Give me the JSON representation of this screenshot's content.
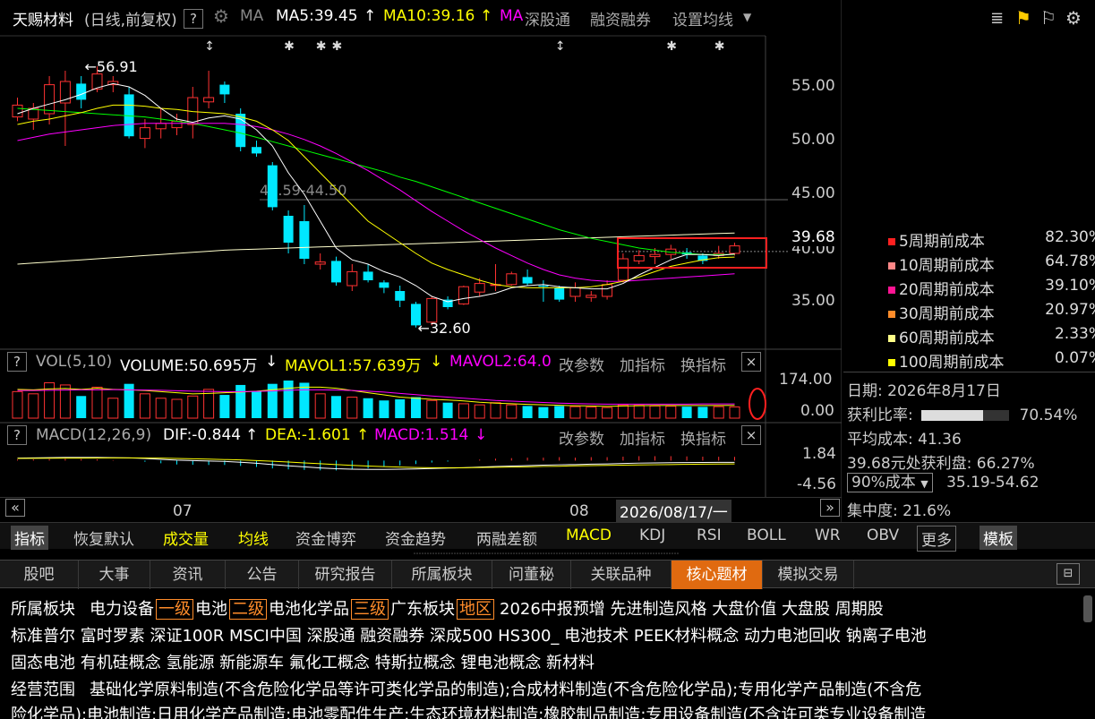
{
  "header": {
    "stock_name": "天赐材料",
    "period_mode": "(日线,前复权)",
    "help": "?",
    "ma_label": "MA",
    "ma5": "MA5:39.45",
    "ma10": "MA10:39.16",
    "ma_more": "MA",
    "shgt": "深股通",
    "rzrq": "融资融券",
    "set_ma": "设置均线",
    "arrow_up": "↑"
  },
  "colors": {
    "up": "#ff3232",
    "down": "#00e8ff",
    "ma5": "#ffffff",
    "ma10": "#ffff00",
    "ma20": "#ff00ff",
    "ma60": "#00ff00",
    "orange": "#ff8c2a",
    "tab_active": "#e06a10"
  },
  "price_axis": {
    "ticks": [
      "55.00",
      "50.00",
      "45.00",
      "40.00",
      "35.00"
    ],
    "current": "39.68",
    "high_label": "56.91",
    "low_label": "32.60",
    "range_label": "44.59-44.50"
  },
  "chip_legend": [
    {
      "label": "5周期前成本",
      "pct": "82.30%",
      "color": "#ff2020"
    },
    {
      "label": "10周期前成本",
      "pct": "64.78%",
      "color": "#ff8888"
    },
    {
      "label": "20周期前成本",
      "pct": "39.10%",
      "color": "#ff1493"
    },
    {
      "label": "30周期前成本",
      "pct": "20.97%",
      "color": "#ff8c2a"
    },
    {
      "label": "60周期前成本",
      "pct": "2.33%",
      "color": "#ffff88"
    },
    {
      "label": "100周期前成本",
      "pct": "0.07%",
      "color": "#ffff00"
    }
  ],
  "chip_info": {
    "date_label": "日期:",
    "date": "2026年8月17日",
    "profit_label": "获利比率:",
    "profit_ratio": 0.7054,
    "profit_pct": "70.54%",
    "avg_cost": "平均成本: 41.36",
    "profit_at": "39.68元处获利盘: 66.27%",
    "cost_select": "90%成本",
    "cost_range": "35.19-54.62",
    "concentration": "集中度: 21.6%"
  },
  "volume": {
    "help": "?",
    "title": "VOL(5,10)",
    "volume": "VOLUME:50.695万",
    "mavol1": "MAVOL1:57.639万",
    "mavol2": "MAVOL2:64.0",
    "down_arrow": "↓",
    "ticks": [
      "174.00",
      "0.00"
    ],
    "btn_params": "改参数",
    "btn_add": "加指标",
    "btn_switch": "换指标",
    "close": "×"
  },
  "macd": {
    "help": "?",
    "title": "MACD(12,26,9)",
    "dif": "DIF:-0.844",
    "dea": "DEA:-1.601",
    "macd": "MACD:1.514",
    "up_arrow": "↑",
    "down_arrow": "↓",
    "ticks": [
      "1.84",
      "-4.56"
    ],
    "btn_params": "改参数",
    "btn_add": "加指标",
    "btn_switch": "换指标",
    "close": "×"
  },
  "time_axis": {
    "labels": [
      "07",
      "08"
    ],
    "cursor_date": "2026/08/17/一",
    "left_btn": "«",
    "right_btn": "»"
  },
  "indicator_tabs": [
    "指标",
    "恢复默认",
    "成交量",
    "均线",
    "资金博弈",
    "资金趋势",
    "两融差额",
    "MACD",
    "KDJ",
    "RSI",
    "BOLL",
    "WR",
    "OBV",
    "更多",
    "模板"
  ],
  "info_tabs": [
    "股吧",
    "大事",
    "资讯",
    "公告",
    "研究报告",
    "所属板块",
    "问董秘",
    "关联品种",
    "核心题材",
    "模拟交易"
  ],
  "info_active": "核心题材",
  "sectors": {
    "label": "所属板块",
    "line1": [
      {
        "t": "电力设备",
        "lv": "一级"
      },
      {
        "t": "电池",
        "lv": "二级"
      },
      {
        "t": "电池化学品",
        "lv": "三级"
      },
      {
        "t": "广东板块",
        "lv": "地区"
      },
      {
        "t": "2026中报预增 先进制造风格 大盘价值 大盘股 周期股",
        "lv": ""
      }
    ],
    "line2": "标准普尔 富时罗素 深证100R MSCI中国 深股通 融资融券 深成500 HS300_ 电池技术 PEEK材料概念 动力电池回收 钠离子电池",
    "line3": "固态电池 有机硅概念 氢能源 新能源车 氟化工概念 特斯拉概念 锂电池概念 新材料"
  },
  "scope": {
    "label": "经营范围",
    "line1": "基础化学原料制造(不含危险化学品等许可类化学品的制造);合成材料制造(不含危险化学品);专用化学产品制造(不含危",
    "line2": "险化学品);电池制造;日用化学产品制造;电池零配件生产;生态环境材料制造;橡胶制品制造;专用设备制造(不含许可类专业设备制造"
  },
  "chart_data": {
    "type": "candlestick",
    "ylim": [
      32,
      58
    ],
    "candles": [
      {
        "o": 52.2,
        "c": 53.3,
        "h": 54.0,
        "l": 51.8
      },
      {
        "o": 52.0,
        "c": 53.0,
        "h": 53.5,
        "l": 51.0
      },
      {
        "o": 52.5,
        "c": 55.2,
        "h": 56.0,
        "l": 51.5
      },
      {
        "o": 53.5,
        "c": 55.5,
        "h": 56.5,
        "l": 49.5
      },
      {
        "o": 55.3,
        "c": 53.8,
        "h": 56.0,
        "l": 53.0
      },
      {
        "o": 54.8,
        "c": 56.2,
        "h": 56.91,
        "l": 54.5
      },
      {
        "o": 55.2,
        "c": 55.5,
        "h": 56.0,
        "l": 54.5
      },
      {
        "o": 54.3,
        "c": 50.4,
        "h": 55.0,
        "l": 50.2
      },
      {
        "o": 50.2,
        "c": 51.2,
        "h": 52.0,
        "l": 49.3
      },
      {
        "o": 51.1,
        "c": 51.6,
        "h": 53.0,
        "l": 50.2
      },
      {
        "o": 51.2,
        "c": 51.8,
        "h": 52.5,
        "l": 50.5
      },
      {
        "o": 51.5,
        "c": 54.0,
        "h": 55.0,
        "l": 50.2
      },
      {
        "o": 53.6,
        "c": 54.0,
        "h": 56.5,
        "l": 53.0
      },
      {
        "o": 55.2,
        "c": 54.3,
        "h": 55.5,
        "l": 53.5
      },
      {
        "o": 52.5,
        "c": 49.4,
        "h": 53.0,
        "l": 49.0
      },
      {
        "o": 49.4,
        "c": 48.8,
        "h": 50.0,
        "l": 48.5
      },
      {
        "o": 47.7,
        "c": 43.8,
        "h": 48.0,
        "l": 43.5
      },
      {
        "o": 43.0,
        "c": 40.5,
        "h": 43.5,
        "l": 39.5
      },
      {
        "o": 42.5,
        "c": 39.0,
        "h": 44.0,
        "l": 38.5
      },
      {
        "o": 38.5,
        "c": 38.7,
        "h": 39.5,
        "l": 38.0
      },
      {
        "o": 38.8,
        "c": 36.8,
        "h": 39.2,
        "l": 36.5
      },
      {
        "o": 36.5,
        "c": 37.8,
        "h": 38.5,
        "l": 36.0
      },
      {
        "o": 37.8,
        "c": 37.0,
        "h": 38.5,
        "l": 36.8
      },
      {
        "o": 36.8,
        "c": 36.3,
        "h": 37.0,
        "l": 35.8
      },
      {
        "o": 36.0,
        "c": 35.1,
        "h": 36.5,
        "l": 34.5
      },
      {
        "o": 34.8,
        "c": 32.8,
        "h": 35.0,
        "l": 32.6
      },
      {
        "o": 33.1,
        "c": 35.3,
        "h": 35.5,
        "l": 32.8
      },
      {
        "o": 35.2,
        "c": 34.5,
        "h": 35.5,
        "l": 34.3
      },
      {
        "o": 34.8,
        "c": 36.4,
        "h": 36.5,
        "l": 34.7
      },
      {
        "o": 35.9,
        "c": 36.7,
        "h": 37.2,
        "l": 35.5
      },
      {
        "o": 36.6,
        "c": 36.6,
        "h": 38.5,
        "l": 36.0
      },
      {
        "o": 36.6,
        "c": 37.6,
        "h": 37.8,
        "l": 36.5
      },
      {
        "o": 37.3,
        "c": 36.7,
        "h": 38.0,
        "l": 36.5
      },
      {
        "o": 36.5,
        "c": 36.4,
        "h": 37.0,
        "l": 35.0
      },
      {
        "o": 36.3,
        "c": 35.2,
        "h": 36.5,
        "l": 35.0
      },
      {
        "o": 35.5,
        "c": 36.3,
        "h": 36.8,
        "l": 35.0
      },
      {
        "o": 35.4,
        "c": 35.6,
        "h": 36.0,
        "l": 35.0
      },
      {
        "o": 35.5,
        "c": 36.6,
        "h": 37.0,
        "l": 35.2
      },
      {
        "o": 37.0,
        "c": 39.0,
        "h": 39.5,
        "l": 36.8
      },
      {
        "o": 38.8,
        "c": 39.3,
        "h": 39.8,
        "l": 38.5
      },
      {
        "o": 39.2,
        "c": 39.4,
        "h": 40.0,
        "l": 38.5
      },
      {
        "o": 39.4,
        "c": 39.9,
        "h": 40.3,
        "l": 39.0
      },
      {
        "o": 39.6,
        "c": 39.4,
        "h": 40.0,
        "l": 39.0
      },
      {
        "o": 39.3,
        "c": 38.8,
        "h": 39.5,
        "l": 38.5
      },
      {
        "o": 39.3,
        "c": 39.5,
        "h": 40.2,
        "l": 39.0
      },
      {
        "o": 39.5,
        "c": 40.2,
        "h": 40.5,
        "l": 39.3
      }
    ],
    "ma5": [
      52.5,
      53.0,
      53.4,
      53.8,
      54.3,
      54.9,
      55.3,
      55.0,
      54.2,
      53.0,
      52.0,
      51.7,
      52.1,
      52.3,
      52.0,
      51.0,
      49.5,
      47.0,
      45.0,
      42.5,
      40.0,
      38.9,
      38.5,
      37.8,
      37.3,
      36.5,
      35.5,
      35.0,
      35.3,
      35.5,
      35.8,
      36.3,
      36.5,
      36.6,
      36.4,
      36.3,
      36.2,
      36.2,
      36.7,
      37.5,
      38.2,
      38.9,
      39.4,
      39.4,
      39.3,
      39.45
    ],
    "ma10": [
      51.5,
      51.8,
      52.0,
      52.3,
      52.6,
      53.0,
      53.3,
      53.3,
      53.2,
      53.0,
      52.9,
      52.7,
      52.6,
      52.5,
      52.2,
      51.8,
      51.0,
      50.0,
      48.5,
      47.0,
      45.5,
      44.0,
      42.5,
      41.5,
      40.5,
      39.5,
      38.6,
      38.0,
      37.5,
      37.0,
      36.6,
      36.4,
      36.3,
      36.3,
      36.3,
      36.3,
      36.4,
      36.6,
      36.9,
      37.3,
      37.8,
      38.3,
      38.6,
      38.9,
      39.1,
      39.16
    ],
    "ma20": [
      50.0,
      50.3,
      50.6,
      50.8,
      51.0,
      51.2,
      51.4,
      51.5,
      51.6,
      51.6,
      51.6,
      51.6,
      51.6,
      51.6,
      51.5,
      51.3,
      51.0,
      50.6,
      50.1,
      49.5,
      48.8,
      48.0,
      47.2,
      46.3,
      45.4,
      44.4,
      43.4,
      42.5,
      41.6,
      40.8,
      40.0,
      39.3,
      38.6,
      38.0,
      37.5,
      37.2,
      37.0,
      36.9,
      36.9,
      37.0,
      37.1,
      37.2,
      37.3,
      37.4,
      37.5,
      37.6
    ],
    "ma60": [
      53.0,
      52.9,
      52.8,
      52.7,
      52.6,
      52.5,
      52.4,
      52.3,
      52.2,
      52.0,
      51.8,
      51.6,
      51.3,
      51.0,
      50.7,
      50.3,
      49.9,
      49.5,
      49.1,
      48.7,
      48.3,
      47.9,
      47.5,
      47.1,
      46.6,
      46.2,
      45.7,
      45.2,
      44.7,
      44.2,
      43.7,
      43.2,
      42.7,
      42.2,
      41.7,
      41.3,
      40.9,
      40.6,
      40.3,
      40.0,
      39.8,
      39.6,
      39.5,
      39.4,
      39.4,
      39.4
    ],
    "ma250": [
      38.5,
      38.6,
      38.7,
      38.8,
      38.9,
      39.0,
      39.1,
      39.2,
      39.3,
      39.4,
      39.5,
      39.6,
      39.7,
      39.8,
      39.85,
      39.9,
      39.95,
      40.0,
      40.05,
      40.1,
      40.15,
      40.2,
      40.25,
      40.3,
      40.35,
      40.4,
      40.45,
      40.5,
      40.55,
      40.6,
      40.65,
      40.7,
      40.75,
      40.8,
      40.85,
      40.9,
      40.95,
      41.0,
      41.05,
      41.1,
      41.15,
      41.2,
      41.25,
      41.3,
      41.35,
      41.4
    ],
    "volume_ylim": [
      0,
      174
    ],
    "volumes": [
      120,
      110,
      160,
      150,
      100,
      140,
      90,
      155,
      110,
      90,
      85,
      100,
      130,
      105,
      150,
      120,
      155,
      170,
      160,
      110,
      100,
      95,
      90,
      80,
      85,
      95,
      80,
      70,
      65,
      60,
      70,
      60,
      55,
      50,
      55,
      52,
      50,
      48,
      60,
      58,
      55,
      54,
      52,
      51,
      52,
      50.7
    ],
    "mavol1": [
      130,
      128,
      132,
      134,
      130,
      135,
      130,
      128,
      125,
      120,
      115,
      110,
      112,
      115,
      118,
      122,
      128,
      135,
      140,
      140,
      135,
      125,
      115,
      105,
      95,
      90,
      85,
      82,
      78,
      72,
      68,
      65,
      62,
      60,
      58,
      56,
      55,
      53,
      55,
      56,
      57,
      57,
      57,
      57,
      57,
      57.6
    ],
    "mavol2": [
      125,
      125,
      126,
      127,
      128,
      128,
      129,
      128,
      127,
      126,
      124,
      122,
      121,
      120,
      120,
      121,
      123,
      126,
      128,
      128,
      127,
      125,
      122,
      118,
      112,
      106,
      100,
      95,
      90,
      85,
      80,
      77,
      74,
      71,
      68,
      66,
      64,
      63,
      63,
      63,
      63,
      63,
      63,
      64,
      64,
      64
    ],
    "macd_ylim": [
      -4.56,
      1.84
    ],
    "dif": [
      1.2,
      1.3,
      1.4,
      1.5,
      1.5,
      1.5,
      1.4,
      1.3,
      1.0,
      0.6,
      0.2,
      0.0,
      -0.2,
      -0.4,
      -0.8,
      -1.3,
      -1.9,
      -2.5,
      -3.0,
      -3.5,
      -3.9,
      -4.1,
      -4.2,
      -4.2,
      -4.1,
      -4.0,
      -3.8,
      -3.6,
      -3.4,
      -3.1,
      -2.8,
      -2.6,
      -2.4,
      -2.2,
      -2.0,
      -1.9,
      -1.7,
      -1.6,
      -1.4,
      -1.2,
      -1.1,
      -1.0,
      -0.95,
      -0.9,
      -0.87,
      -0.844
    ],
    "dea": [
      1.0,
      1.05,
      1.1,
      1.15,
      1.2,
      1.25,
      1.3,
      1.3,
      1.25,
      1.15,
      1.0,
      0.85,
      0.7,
      0.5,
      0.3,
      0.0,
      -0.3,
      -0.7,
      -1.1,
      -1.5,
      -1.9,
      -2.3,
      -2.6,
      -2.9,
      -3.1,
      -3.3,
      -3.4,
      -3.4,
      -3.4,
      -3.3,
      -3.2,
      -3.1,
      -3.0,
      -2.8,
      -2.7,
      -2.5,
      -2.4,
      -2.3,
      -2.2,
      -2.1,
      -2.0,
      -1.9,
      -1.8,
      -1.7,
      -1.65,
      -1.601
    ],
    "macd_hist": [
      0.4,
      0.5,
      0.6,
      0.7,
      0.6,
      0.5,
      0.2,
      0.0,
      -0.5,
      -1.1,
      -1.6,
      -1.7,
      -1.8,
      -1.8,
      -2.2,
      -2.6,
      -3.2,
      -3.6,
      -3.8,
      -4.0,
      -4.0,
      -3.6,
      -3.2,
      -2.6,
      -2.0,
      -1.4,
      -0.8,
      -0.4,
      0.0,
      0.4,
      0.8,
      1.0,
      1.2,
      1.2,
      1.4,
      1.2,
      1.4,
      1.4,
      1.6,
      1.8,
      1.8,
      1.8,
      1.7,
      1.6,
      1.56,
      1.514
    ],
    "signals": [
      {
        "i": 12,
        "s": "↕"
      },
      {
        "i": 17,
        "s": "✱"
      },
      {
        "i": 19,
        "s": "✱"
      },
      {
        "i": 20,
        "s": "✱"
      },
      {
        "i": 34,
        "s": "↕"
      },
      {
        "i": 41,
        "s": "✱"
      },
      {
        "i": 44,
        "s": "✱"
      }
    ]
  }
}
